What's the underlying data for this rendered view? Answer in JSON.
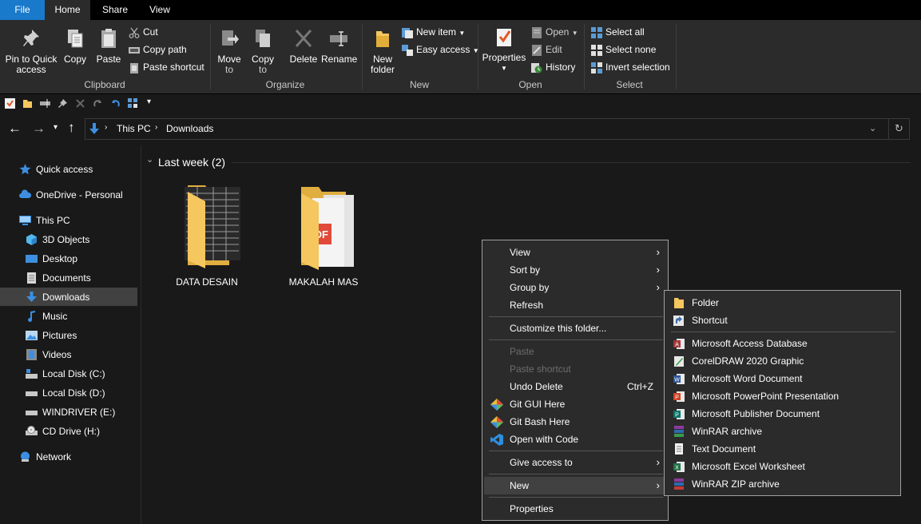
{
  "tabs": {
    "file": "File",
    "home": "Home",
    "share": "Share",
    "view": "View"
  },
  "ribbon": {
    "clipboard": {
      "pin_line1": "Pin to Quick",
      "pin_line2": "access",
      "copy": "Copy",
      "paste": "Paste",
      "cut": "Cut",
      "copy_path": "Copy path",
      "paste_shortcut": "Paste shortcut",
      "label": "Clipboard"
    },
    "organize": {
      "move_line1": "Move",
      "move_line2": "to",
      "copy_line1": "Copy",
      "copy_line2": "to",
      "delete": "Delete",
      "rename": "Rename",
      "label": "Organize"
    },
    "new": {
      "folder_line1": "New",
      "folder_line2": "folder",
      "new_item": "New item",
      "easy_access": "Easy access",
      "label": "New"
    },
    "open": {
      "properties": "Properties",
      "open": "Open",
      "edit": "Edit",
      "history": "History",
      "label": "Open"
    },
    "select": {
      "select_all": "Select all",
      "select_none": "Select none",
      "invert": "Invert selection",
      "label": "Select"
    }
  },
  "address": {
    "crumb1": "This PC",
    "crumb2": "Downloads"
  },
  "nav": {
    "quick_access": "Quick access",
    "onedrive": "OneDrive - Personal",
    "this_pc": "This PC",
    "objects3d": "3D Objects",
    "desktop": "Desktop",
    "documents": "Documents",
    "downloads": "Downloads",
    "music": "Music",
    "pictures": "Pictures",
    "videos": "Videos",
    "local_c": "Local Disk (C:)",
    "local_d": "Local Disk (D:)",
    "windriver": "WINDRIVER (E:)",
    "cd_drive": "CD Drive (H:)",
    "network": "Network"
  },
  "content": {
    "group_header": "Last week (2)",
    "files": [
      {
        "name": "DATA DESAIN"
      },
      {
        "name": "MAKALAH MAS"
      }
    ]
  },
  "context_menu": {
    "view": "View",
    "sort_by": "Sort by",
    "group_by": "Group by",
    "refresh": "Refresh",
    "customize": "Customize this folder...",
    "paste": "Paste",
    "paste_shortcut": "Paste shortcut",
    "undo_delete": "Undo Delete",
    "undo_shortcut": "Ctrl+Z",
    "git_gui": "Git GUI Here",
    "git_bash": "Git Bash Here",
    "open_code": "Open with Code",
    "give_access": "Give access to",
    "new": "New",
    "properties": "Properties"
  },
  "new_submenu": {
    "folder": "Folder",
    "shortcut": "Shortcut",
    "access": "Microsoft Access Database",
    "coreldraw": "CorelDRAW 2020 Graphic",
    "word": "Microsoft Word Document",
    "powerpoint": "Microsoft PowerPoint Presentation",
    "publisher": "Microsoft Publisher Document",
    "winrar": "WinRAR archive",
    "text": "Text Document",
    "excel": "Microsoft Excel Worksheet",
    "winrar_zip": "WinRAR ZIP archive"
  },
  "colors": {
    "accent": "#1979ca",
    "background": "#191919",
    "ribbon": "#2b2b2b",
    "folder": "#f5c75e"
  }
}
